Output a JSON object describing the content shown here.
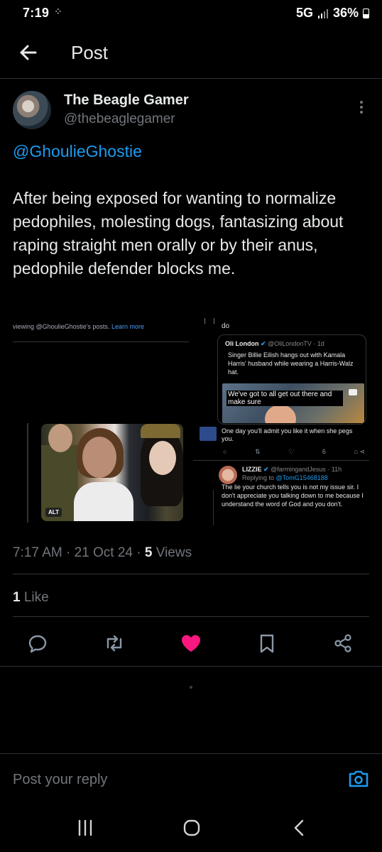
{
  "status_bar": {
    "time": "7:19",
    "network": "5G",
    "battery": "36%"
  },
  "header": {
    "title": "Post"
  },
  "post": {
    "author_name": "The Beagle Gamer",
    "author_handle": "@thebeaglegamer",
    "mention": "@GhoulieGhostie",
    "text": "After being exposed for wanting to normalize pedophiles, molesting dogs, fantasizing about raping straight men orally or by their anus, pedophile defender blocks me.",
    "time": "7:17 AM",
    "date": "21 Oct 24",
    "views_count": "5",
    "views_label": "Views",
    "likes_count": "1",
    "likes_label": "Like"
  },
  "embedded": {
    "viewing_text": "viewing @GhoulieGhostie's posts.",
    "learn_more": "Learn more",
    "do_text": "do",
    "quote_author": "Oli London",
    "quote_handle": "@OliLondonTV · 1d",
    "quote_text": "Singer Billie Eilish hangs out with Kamala Harris' husband while wearing a Harris-Walz hat.",
    "video_caption": "We've got to all get out there and make sure",
    "alt_label": "ALT",
    "reply1_text": "One day you'll admit you like it when she pegs you.",
    "reply1_views": "6",
    "reply2_author": "LIZZIE",
    "reply2_handle": "@farmingandJesus · 11h",
    "reply2_replying": "Replying to",
    "reply2_replying_to": "@TomG15468188",
    "reply2_text": "The lie your church tells you is not my issue sir. I don't appreciate you talking down to me because I understand the word of God and you don't."
  },
  "reply_bar": {
    "placeholder": "Post your reply"
  },
  "colors": {
    "accent": "#1d9bf0",
    "like": "#f91880",
    "muted": "#71767b"
  }
}
